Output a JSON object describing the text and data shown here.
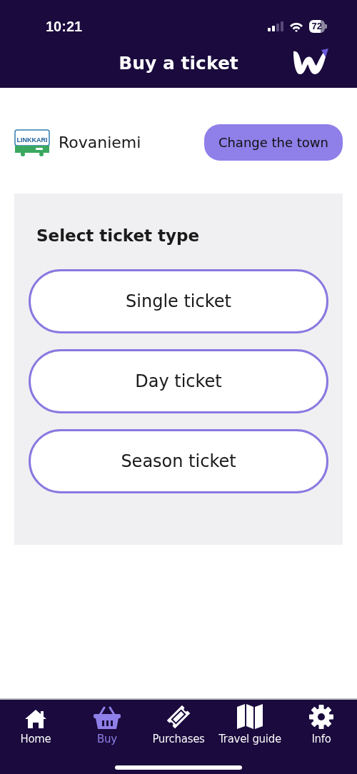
{
  "status_bar": {
    "time": "10:21",
    "battery": "72"
  },
  "header": {
    "title": "Buy a ticket"
  },
  "town": {
    "logo_text": "LINKKARI",
    "name": "Rovaniemi",
    "change_button": "Change the town"
  },
  "ticket_panel": {
    "heading": "Select ticket type",
    "options": [
      {
        "label": "Single ticket"
      },
      {
        "label": "Day ticket"
      },
      {
        "label": "Season ticket"
      }
    ]
  },
  "tab_bar": [
    {
      "kind": "home",
      "label": "Home",
      "selected": false
    },
    {
      "kind": "basket",
      "label": "Buy",
      "selected": true
    },
    {
      "kind": "ticket",
      "label": "Purchases",
      "selected": false
    },
    {
      "kind": "map",
      "label": "Travel guide",
      "selected": false
    },
    {
      "kind": "gear",
      "label": "Info",
      "selected": false
    }
  ]
}
